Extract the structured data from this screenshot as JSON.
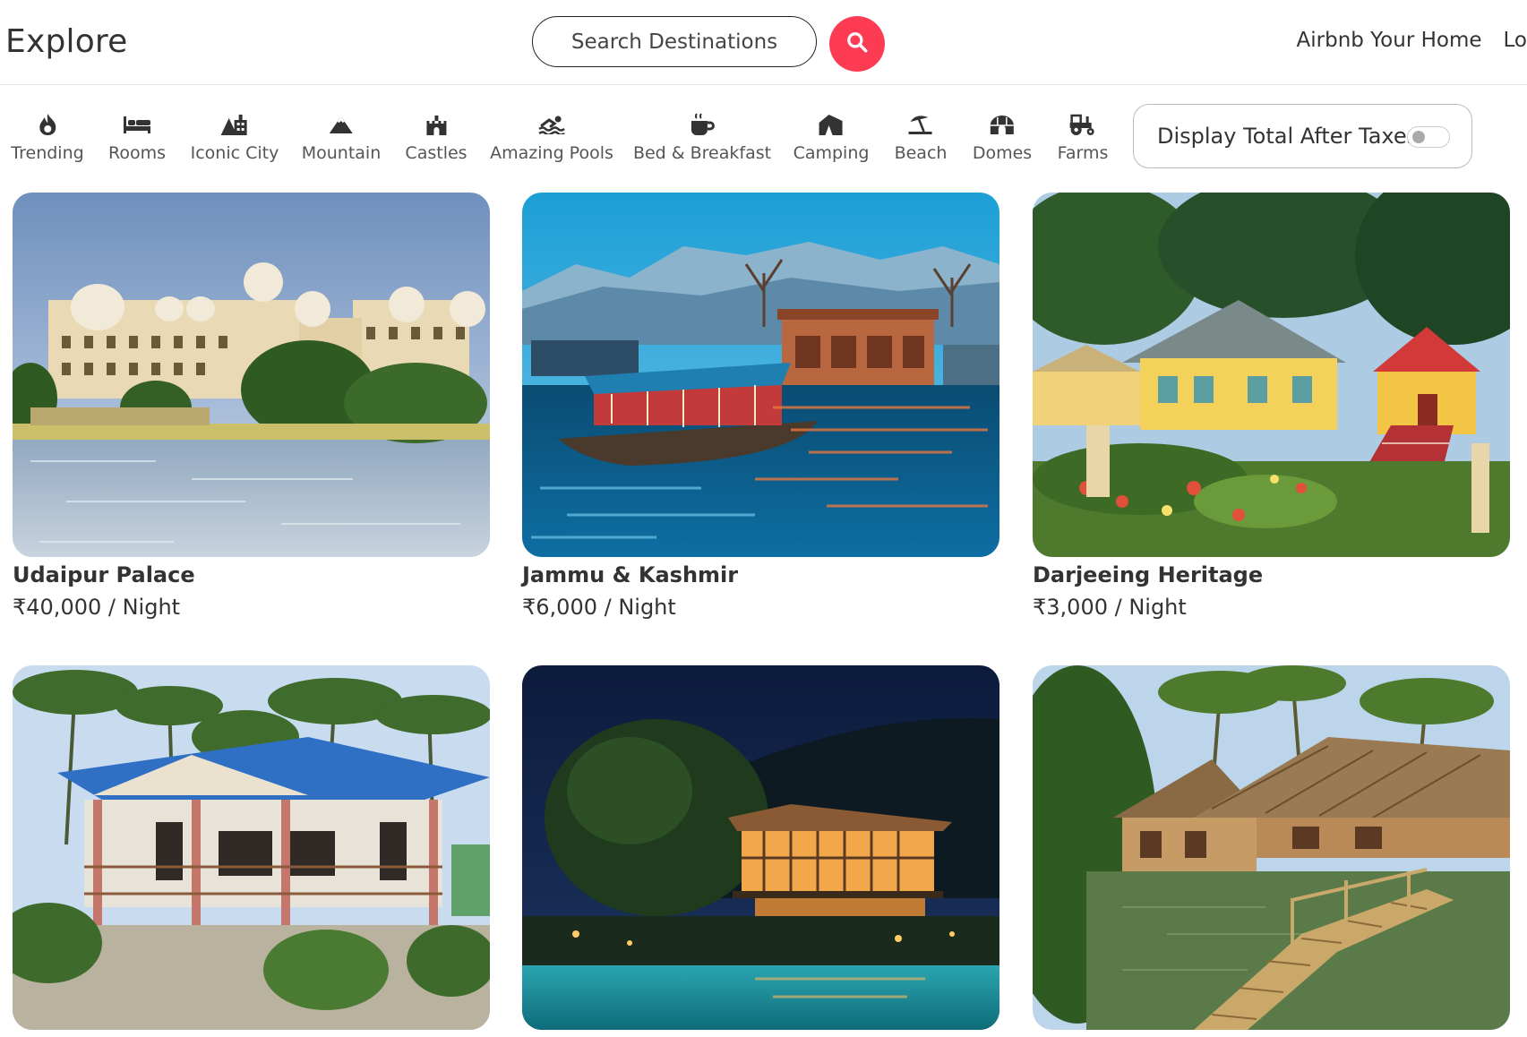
{
  "header": {
    "brand": "Explore",
    "search_placeholder": "Search Destinations",
    "search_icon": "search-icon",
    "nav_links": [
      "Airbnb Your Home",
      "Lo"
    ]
  },
  "colors": {
    "accent": "#fd3b53",
    "text": "#333333",
    "muted": "#555555",
    "border": "#e2e2e2"
  },
  "filters": [
    {
      "label": "Trending",
      "icon": "fire-icon"
    },
    {
      "label": "Rooms",
      "icon": "bed-icon"
    },
    {
      "label": "Iconic City",
      "icon": "city-icon"
    },
    {
      "label": "Mountain",
      "icon": "mountain-icon"
    },
    {
      "label": "Castles",
      "icon": "castle-icon"
    },
    {
      "label": "Amazing Pools",
      "icon": "swimmer-icon"
    },
    {
      "label": "Bed & Breakfast",
      "icon": "mug-icon"
    },
    {
      "label": "Camping",
      "icon": "tent-icon"
    },
    {
      "label": "Beach",
      "icon": "umbrella-beach-icon"
    },
    {
      "label": "Domes",
      "icon": "igloo-icon"
    },
    {
      "label": "Farms",
      "icon": "tractor-icon"
    }
  ],
  "tax_toggle": {
    "label": "Display Total After Taxes",
    "enabled": false
  },
  "listings": [
    {
      "title": "Udaipur Palace",
      "price": "₹40,000 / Night",
      "image": "palace-lake-photo"
    },
    {
      "title": "Jammu & Kashmir",
      "price": "₹6,000 / Night",
      "image": "houseboat-lake-photo"
    },
    {
      "title": "Darjeeing Heritage",
      "price": "₹3,000 / Night",
      "image": "heritage-garden-photo"
    },
    {
      "title": "",
      "price": "",
      "image": "blue-roof-cottage-photo"
    },
    {
      "title": "",
      "price": "",
      "image": "night-villa-pool-photo"
    },
    {
      "title": "",
      "price": "",
      "image": "thatched-hut-backwater-photo"
    }
  ]
}
